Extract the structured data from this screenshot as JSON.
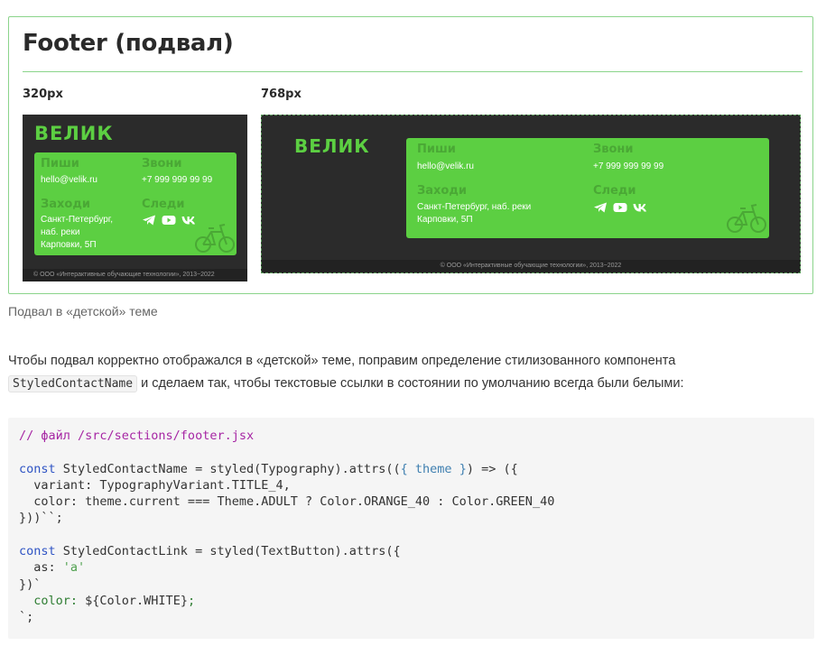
{
  "figure": {
    "title": "Footer (подвал)",
    "breakpoints": [
      "320px",
      "768px"
    ],
    "mock": {
      "logo": "ВЕЛИК",
      "write_label": "Пиши",
      "email": "hello@velik.ru",
      "call_label": "Звони",
      "phone": "+7 999 999 99 99",
      "visit_label": "Заходи",
      "address_320": [
        "Санкт-Петербург,",
        "наб. реки",
        "Карповки, 5П"
      ],
      "address_768": [
        "Санкт-Петербург, наб. реки",
        "Карповки, 5П"
      ],
      "follow_label": "Следи",
      "social_icons": [
        "telegram-icon",
        "youtube-icon",
        "vk-icon"
      ],
      "copyright": "© ООО «Интерактивные обучающие технологии», 2013−2022",
      "colors": {
        "background": "#2b2b2b",
        "card": "#5ccf42",
        "logo": "#5ccf42"
      }
    }
  },
  "caption": "Подвал в «детской» теме",
  "paragraph": {
    "before": "Чтобы подвал корректно отображался в «детской» теме, поправим определение стилизованного компонента ",
    "code": "StyledContactName",
    "after": " и сделаем так, чтобы текстовые ссылки в состоянии по умолчанию всегда были белыми:"
  },
  "code": {
    "comment": "// файл /src/sections/footer.jsx",
    "l1_kw": "const",
    "l1_a": " StyledContactName = styled(Typography).attrs((",
    "l1_b": "{ ",
    "l1_param": "theme",
    "l1_c": " }",
    "l1_d": ") => ({",
    "l2": "  variant: TypographyVariant.TITLE_4,",
    "l3": "  color: theme.current === Theme.ADULT ? Color.ORANGE_40 : Color.GREEN_40",
    "l4": "}))``;",
    "l6_kw": "const",
    "l6_a": " StyledContactLink = styled(TextButton).attrs({",
    "l7_a": "  as: ",
    "l7_str": "'a'",
    "l8": "})`",
    "l9_a": "  color: ",
    "l9_b": "${Color.WHITE}",
    "l9_c": ";",
    "l10": "`;"
  }
}
